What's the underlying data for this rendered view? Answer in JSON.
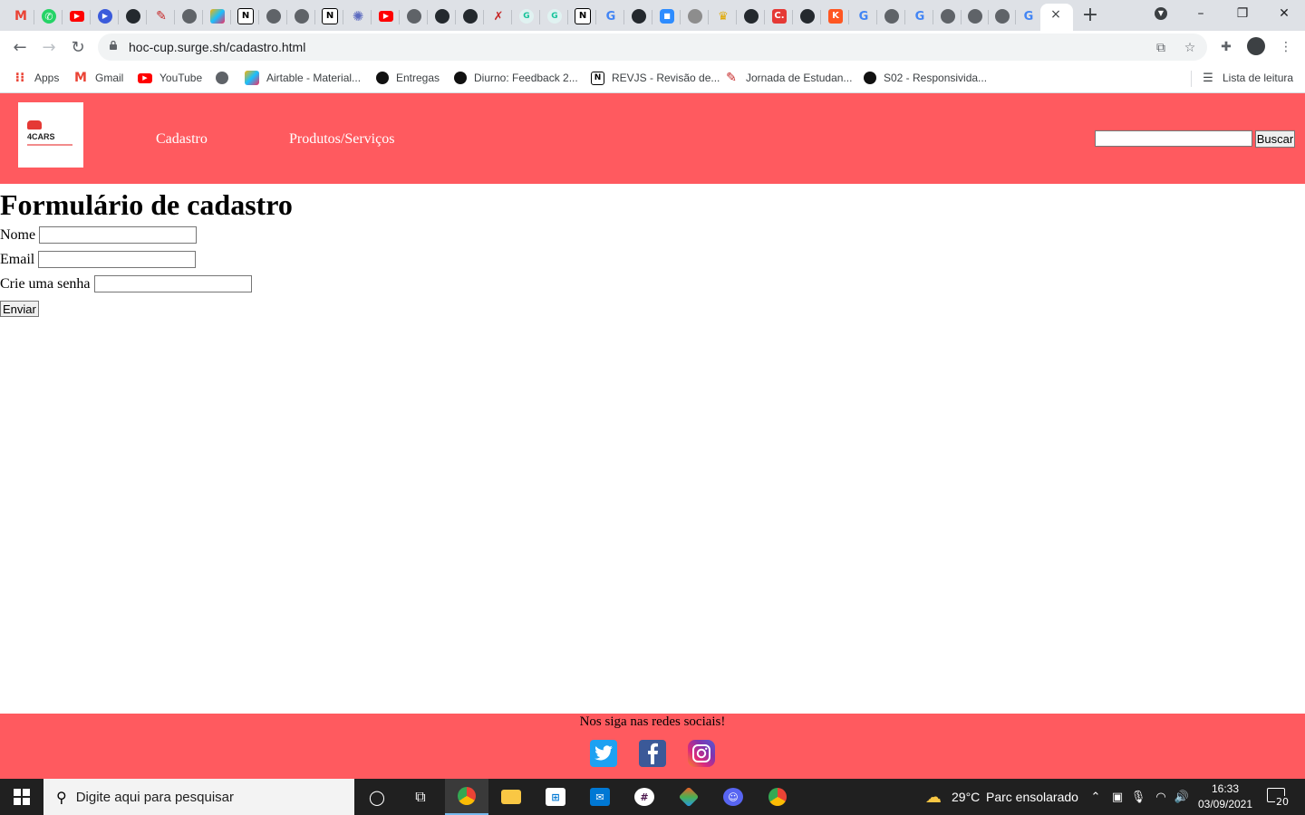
{
  "browser": {
    "tab_close": "×",
    "new_tab": "+",
    "window": {
      "minimize": "–",
      "restore": "❐",
      "close": "✕"
    },
    "url": "hoc-cup.surge.sh/cadastro.html",
    "bookmarks": [
      {
        "label": "Apps",
        "icon": "apps-grid-icon"
      },
      {
        "label": "Gmail",
        "icon": "gmail-icon"
      },
      {
        "label": "YouTube",
        "icon": "youtube-icon"
      },
      {
        "label": "",
        "icon": "globe-icon"
      },
      {
        "label": "Airtable - Material...",
        "icon": "airtable-icon"
      },
      {
        "label": "Entregas",
        "icon": "dot-icon"
      },
      {
        "label": "Diurno: Feedback 2...",
        "icon": "dot-icon"
      },
      {
        "label": "REVJS - Revisão de...",
        "icon": "notion-icon"
      },
      {
        "label": "Jornada de Estudan...",
        "icon": "pencil-icon"
      },
      {
        "label": "S02 - Responsivida...",
        "icon": "dot-icon"
      }
    ],
    "reading_list": "Lista de leitura"
  },
  "site": {
    "logo_text": "4CARS",
    "nav": [
      "Cadastro",
      "Produtos/Serviços"
    ],
    "search_button": "Buscar",
    "search_value": ""
  },
  "form": {
    "title": "Formulário de cadastro",
    "fields": [
      {
        "label": "Nome",
        "value": ""
      },
      {
        "label": "Email",
        "value": ""
      },
      {
        "label": "Crie uma senha",
        "value": ""
      }
    ],
    "submit_label": "Enviar"
  },
  "footer": {
    "text": "Nos siga nas redes sociais!",
    "social": [
      "twitter-icon",
      "facebook-icon",
      "instagram-icon"
    ]
  },
  "taskbar": {
    "search_placeholder": "Digite aqui para pesquisar",
    "weather_temp": "29°C",
    "weather_desc": "Parc ensolarado",
    "time": "16:33",
    "date": "03/09/2021",
    "notifications": "20"
  },
  "colors": {
    "header": "#ff5a5f",
    "footer": "#ff5a5f",
    "tabstrip": "#dee1e6",
    "taskbar": "#202020"
  }
}
